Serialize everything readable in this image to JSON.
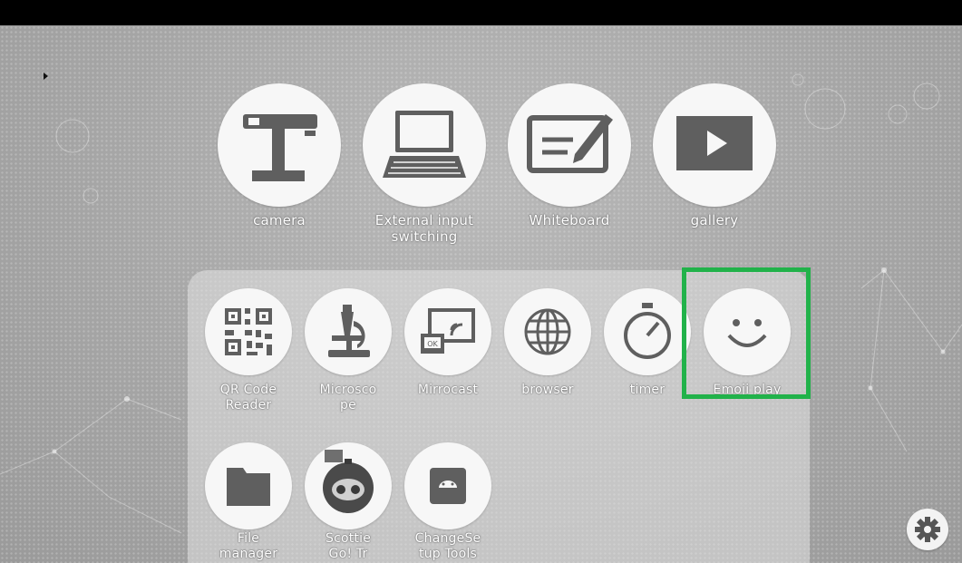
{
  "main_apps": [
    {
      "label": "camera",
      "icon": "document-camera-icon"
    },
    {
      "label": "External input\nswitching",
      "icon": "laptop-icon"
    },
    {
      "label": "Whiteboard",
      "icon": "whiteboard-pen-icon"
    },
    {
      "label": "gallery",
      "icon": "play-video-icon"
    }
  ],
  "drawer_apps": [
    {
      "label": "QR Code\nReader",
      "icon": "qr-code-icon"
    },
    {
      "label": "Microsco\npe",
      "icon": "microscope-icon"
    },
    {
      "label": "Mirrocast",
      "icon": "screen-cast-icon"
    },
    {
      "label": "browser",
      "icon": "globe-icon"
    },
    {
      "label": "timer",
      "icon": "stopwatch-icon"
    },
    {
      "label": "Emoji play",
      "icon": "smiley-icon"
    },
    {
      "label": "File\nmanager",
      "icon": "folder-icon"
    },
    {
      "label": "Scottie\nGo! Tr",
      "icon": "scottie-robot-icon"
    },
    {
      "label": "ChangeSe\ntup Tools",
      "icon": "android-icon"
    }
  ],
  "highlighted_app": "Emoji play",
  "settings": {
    "icon": "gear-icon"
  },
  "colors": {
    "highlight": "#21b24a",
    "icon_dark": "#5f5f5f",
    "icon_circle": "#f7f7f7",
    "top_bar": "#000000"
  }
}
